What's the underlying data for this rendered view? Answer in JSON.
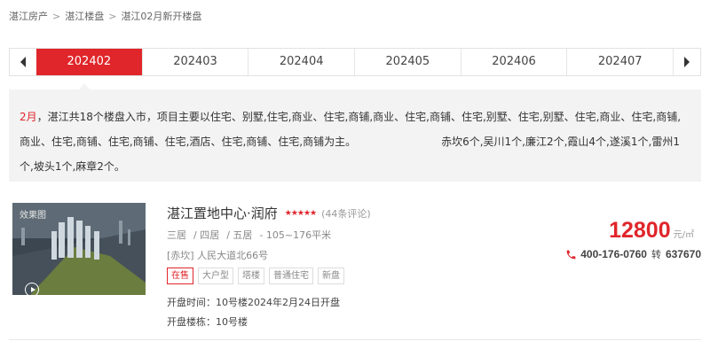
{
  "breadcrumb": {
    "items": [
      "湛江房产",
      "湛江楼盘",
      "湛江02月新开楼盘"
    ],
    "separator": ">"
  },
  "month_tabs": {
    "prev_icon": "chevron-left-icon",
    "next_icon": "chevron-right-icon",
    "items": [
      "202402",
      "202403",
      "202404",
      "202405",
      "202406",
      "202407"
    ],
    "active_index": 0
  },
  "summary": {
    "month": "2月",
    "text": "，湛江共18个楼盘入市，项目主要以住宅、别墅,住宅,商业、住宅,商铺,商业、住宅,商铺、住宅,别墅、住宅,别墅、住宅,商业、住宅,商铺,商业、住宅,商铺、住宅,商铺、住宅,酒店、住宅,商铺、住宅,商铺为主。",
    "districts": "赤坎6个,吴川1个,廉江2个,霞山4个,遂溪1个,雷州1个,坡头1个,麻章2个。"
  },
  "listing": {
    "thumb_label": "效果图",
    "title": "湛江置地中心·润府",
    "rating_stars": 5,
    "reviews": "(44条评论)",
    "rooms": [
      "三居",
      "/ 四居",
      "/ 五居"
    ],
    "area": "- 105~176平米",
    "address": "[赤坎] 人民大道北66号",
    "tags": [
      "在售",
      "大户型",
      "塔楼",
      "普通住宅",
      "新盘"
    ],
    "open_time": "开盘时间：10号楼2024年2月24日开盘",
    "open_buildings": "开盘楼栋：10号楼",
    "price": "12800",
    "price_unit": "元/㎡",
    "phone": "400-176-0760",
    "phone_transfer": "转",
    "phone_ext": "637670",
    "colors": {
      "accent": "#e0262b"
    }
  }
}
